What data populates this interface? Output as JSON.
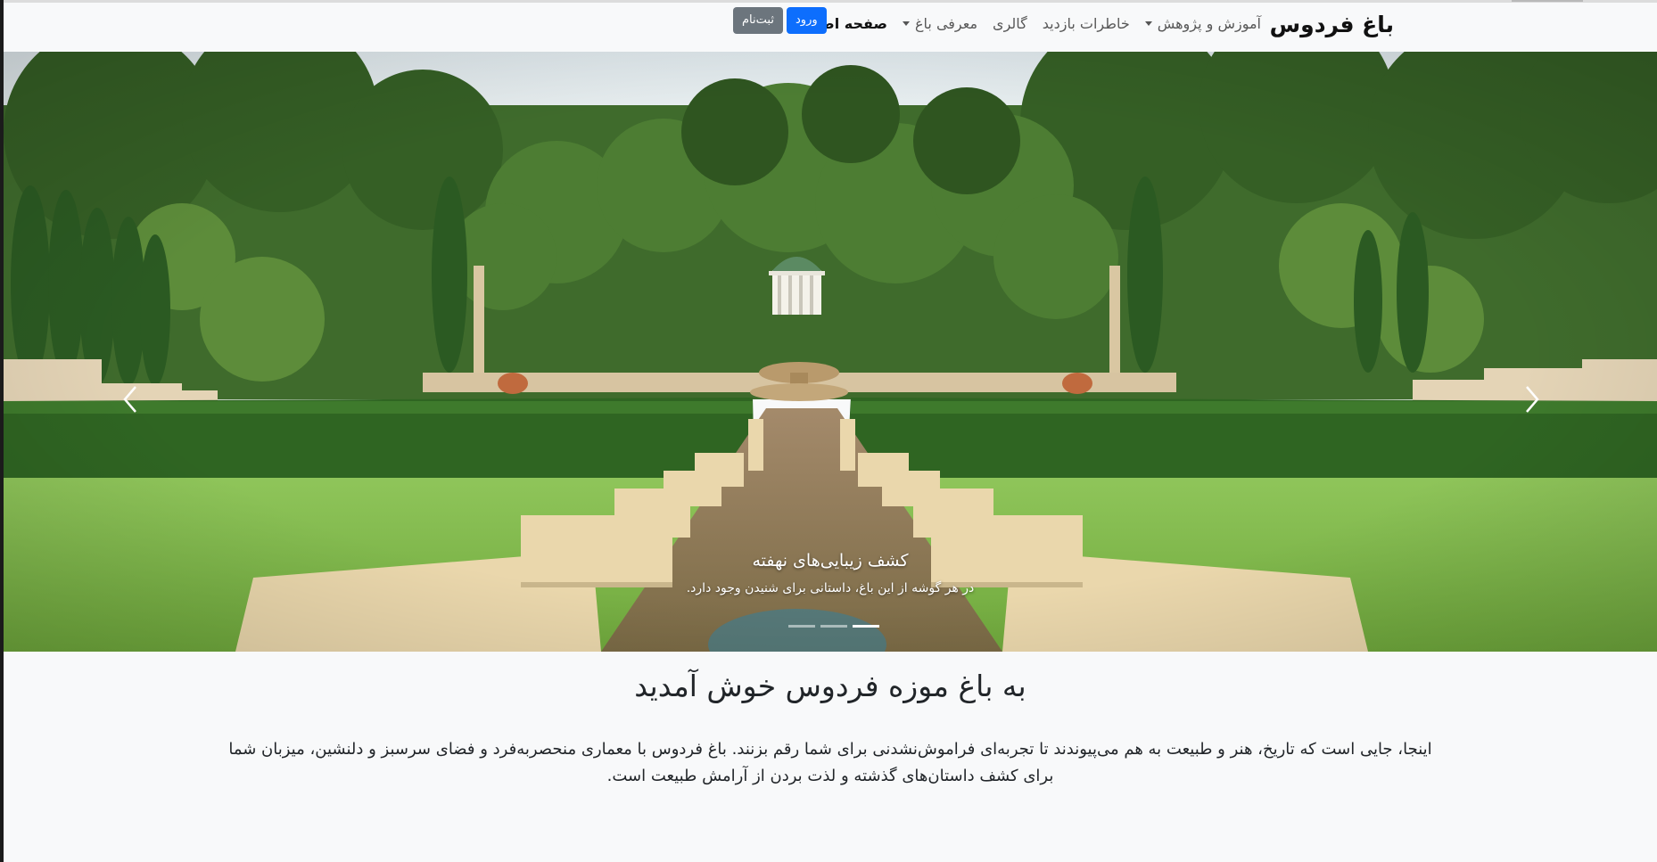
{
  "brand": "باغ فردوس",
  "nav": {
    "items": [
      {
        "label": "صفحه اصلی",
        "active": true,
        "dropdown": false
      },
      {
        "label": "معرفی باغ",
        "active": false,
        "dropdown": true
      },
      {
        "label": "گالری",
        "active": false,
        "dropdown": false
      },
      {
        "label": "خاطرات بازدید",
        "active": false,
        "dropdown": false
      },
      {
        "label": "آموزش و پژوهش",
        "active": false,
        "dropdown": true
      }
    ],
    "login_label": "ورود",
    "register_label": "ثبت‌نام"
  },
  "carousel": {
    "caption_title": "کشف زیبایی‌های نهفته",
    "caption_text": "در هر گوشه از این باغ، داستانی برای شنیدن وجود دارد.",
    "slide_count": 3,
    "active_slide": 3
  },
  "welcome": {
    "title": "به باغ موزه فردوس خوش آمدید",
    "text": "اینجا، جایی است که تاریخ، هنر و طبیعت به هم می‌پیوندند تا تجربه‌ای فراموش‌نشدنی برای شما رقم بزنند. باغ فردوس با معماری منحصربه‌فرد و فضای سرسبز و دلنشین، میزبان شما برای کشف داستان‌های گذشته و لذت بردن از آرامش طبیعت است."
  },
  "colors": {
    "primary": "#0d6efd",
    "secondary": "#6c757d",
    "background": "#f8f9fa"
  }
}
